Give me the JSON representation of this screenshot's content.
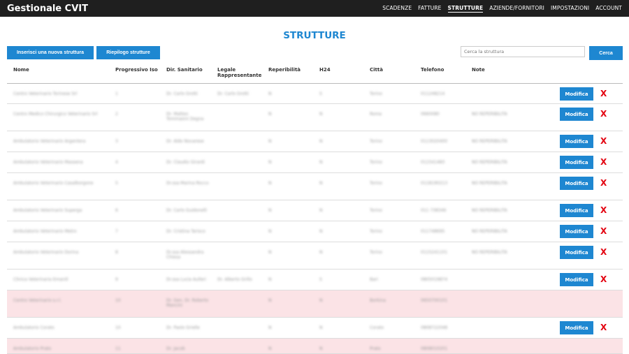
{
  "app": {
    "title": "Gestionale CVIT"
  },
  "nav": [
    {
      "label": "SCADENZE",
      "active": false
    },
    {
      "label": "FATTURE",
      "active": false
    },
    {
      "label": "STRUTTURE",
      "active": true
    },
    {
      "label": "AZIENDE/FORNITORI",
      "active": false
    },
    {
      "label": "IMPOSTAZIONI",
      "active": false
    },
    {
      "label": "ACCOUNT",
      "active": false
    }
  ],
  "page": {
    "title": "STRUTTURE"
  },
  "toolbar": {
    "add_label": "Inserisci una nuova struttura",
    "summary_label": "Riepilogo strutture",
    "search_placeholder": "Cerca la struttura",
    "search_button": "Cerca"
  },
  "table": {
    "headers": [
      "Nome",
      "Progressivo Iso",
      "Dir. Sanitario",
      "Legale Rappresentante",
      "Reperibilità",
      "H24",
      "Città",
      "Telefono",
      "Note"
    ],
    "edit_label": "Modifica",
    "delete_label": "X",
    "rows": [
      {
        "cells": [
          "Centro Veterinario Torinese Srl",
          "1",
          "Dr. Carlo Grotti",
          "Dr. Carlo Grotti",
          "N",
          "S",
          "Torino",
          "011248214",
          ""
        ],
        "highlight": false,
        "actions": true
      },
      {
        "cells": [
          "Centro Medico Chirurgico Veterinario Srl",
          "2",
          "Dr. Matteo Tommasini Degna",
          "",
          "N",
          "N",
          "Roma",
          "0660080",
          "NO REPERIBILITA"
        ],
        "highlight": false,
        "actions": true
      },
      {
        "cells": [
          "Ambulatorio Veterinario Argentera",
          "3",
          "Dr. Aldo Novarese",
          "",
          "N",
          "N",
          "Torino",
          "0113020400",
          "NO REPERIBILITA"
        ],
        "highlight": false,
        "actions": true
      },
      {
        "cells": [
          "Ambulatorio Veterinario Massena",
          "4",
          "Dr. Claudio Girardi",
          "",
          "N",
          "N",
          "Torino",
          "011541483",
          "NO REPERIBILITA"
        ],
        "highlight": false,
        "actions": true
      },
      {
        "cells": [
          "Ambulatorio Veterinario Casalborgone",
          "5",
          "Dr.ssa Marina Rocco",
          "",
          "N",
          "N",
          "Torino",
          "0118190213",
          "NO REPERIBILITA"
        ],
        "highlight": false,
        "actions": true
      },
      {
        "cells": [
          "Ambulatorio Veterinario Superga",
          "6",
          "Dr. Carlo Guidonelli",
          "",
          "N",
          "N",
          "Torino",
          "011 738346",
          "NO REPERIBILITA"
        ],
        "highlight": false,
        "actions": true
      },
      {
        "cells": [
          "Ambulatorio Veterinario Metro",
          "7",
          "Dr. Cristina Tarisco",
          "",
          "N",
          "N",
          "Torino",
          "011748695",
          "NO REPERIBILITA"
        ],
        "highlight": false,
        "actions": true
      },
      {
        "cells": [
          "Ambulatorio Veterinario Dorina",
          "8",
          "Dr.ssa Alessandra Chiesa",
          "",
          "N",
          "N",
          "Torino",
          "0115241101",
          "NO REPERIBILITA"
        ],
        "highlight": false,
        "actions": true
      },
      {
        "cells": [
          "Clinica Veterinaria Emanili",
          "9",
          "Dr.ssa Lucia Aulleri",
          "Dr. Alberto Grillo",
          "N",
          "S",
          "Bari",
          "0805019874",
          ""
        ],
        "highlight": false,
        "actions": true
      },
      {
        "cells": [
          "Centro Veterinario s.r.l.",
          "10",
          "Dr. Gen. Dr. Roberto Mancini",
          "",
          "N",
          "N",
          "Borkina",
          "0650700101",
          ""
        ],
        "highlight": true,
        "actions": false
      },
      {
        "cells": [
          "Ambulatorio Corato",
          "10",
          "Dr. Paolo Grielle",
          "",
          "N",
          "N",
          "Corato",
          "0808722048",
          ""
        ],
        "highlight": false,
        "actions": true
      },
      {
        "cells": [
          "Ambulatorio Prato",
          "11",
          "Dr. Jacob",
          "",
          "N",
          "N",
          "Prato",
          "0808010201",
          ""
        ],
        "highlight": true,
        "actions": false
      }
    ]
  }
}
